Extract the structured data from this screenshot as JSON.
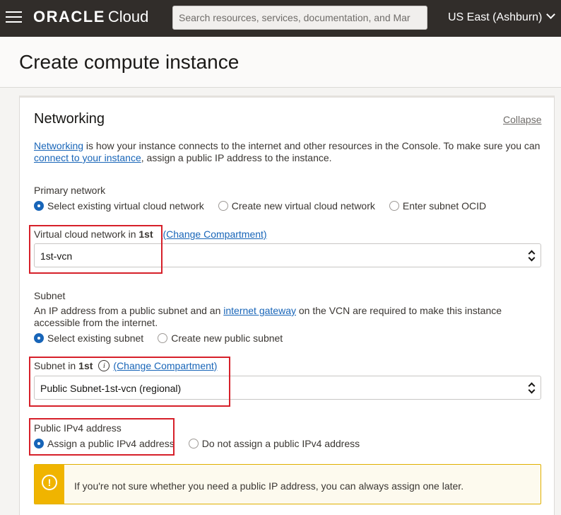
{
  "topbar": {
    "brand": "ORACLE",
    "product": "Cloud",
    "search_placeholder": "Search resources, services, documentation, and Mar",
    "region": "US East (Ashburn)"
  },
  "page": {
    "title": "Create compute instance"
  },
  "networking": {
    "title": "Networking",
    "collapse": "Collapse",
    "desc_link1": "Networking",
    "desc_text1": " is how your instance connects to the internet and other resources in the Console. To make sure you can ",
    "desc_link2": "connect to your instance",
    "desc_text2": ", assign a public IP address to the instance.",
    "primary_network": {
      "label": "Primary network",
      "options": [
        "Select existing virtual cloud network",
        "Create new virtual cloud network",
        "Enter subnet OCID"
      ],
      "selected": 0
    },
    "vcn": {
      "label": "Virtual cloud network in ",
      "compartment": "1st",
      "change": "(Change Compartment)",
      "value": "1st-vcn"
    },
    "subnet": {
      "label": "Subnet",
      "desc1": "An IP address from a public subnet and an ",
      "desc_link": "internet gateway",
      "desc2": " on the VCN are required to make this instance accessible from the internet.",
      "options": [
        "Select existing subnet",
        "Create new public subnet"
      ],
      "selected": 0,
      "field_label": "Subnet in ",
      "compartment": "1st",
      "change": "(Change Compartment)",
      "value": "Public Subnet-1st-vcn (regional)"
    },
    "ipv4": {
      "label": "Public IPv4 address",
      "options": [
        "Assign a public IPv4 address",
        "Do not assign a public IPv4 address"
      ],
      "selected": 0
    },
    "warning": {
      "icon": "!",
      "text": "If you're not sure whether you need a public IP address, you can always assign one later."
    }
  },
  "colors": {
    "topbar": "#312d2a",
    "link": "#1865b8",
    "highlight": "#d6202a",
    "warning": "#f0b400"
  }
}
